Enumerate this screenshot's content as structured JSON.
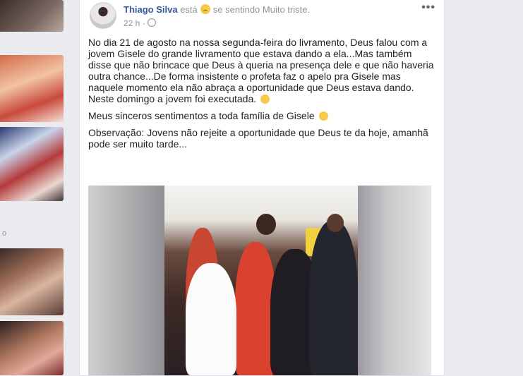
{
  "sidebar": {
    "label": "o"
  },
  "post": {
    "author": "Thiago Silva",
    "activity_prefix": "está",
    "activity_suffix": "se sentindo Muito triste.",
    "timestamp": "22 h",
    "more_label": "•••",
    "paragraphs": [
      "No dia 21 de agosto na nossa segunda-feira do livramento, Deus falou com a jovem Gisele do grande livramento que estava dando a ela...Mas também disse que não brincace que Deus à queria na presença dele e que não haveria outra chance...De forma insistente o profeta faz o apelo pra Gisele mas naquele momento ela não abraça a oportunidade que Deus estava dando.\nNeste domingo a jovem foi executada.",
      "Meus sinceros sentimentos a toda família de Gisele",
      "Observação: Jovens não rejeite a oportunidade que Deus te da hoje, amanhã pode ser muito tarde..."
    ]
  },
  "icons": {
    "feeling": "sad-face-icon",
    "relieved": "relieved-face-icon",
    "privacy": "globe-icon",
    "more": "more-options-icon"
  }
}
